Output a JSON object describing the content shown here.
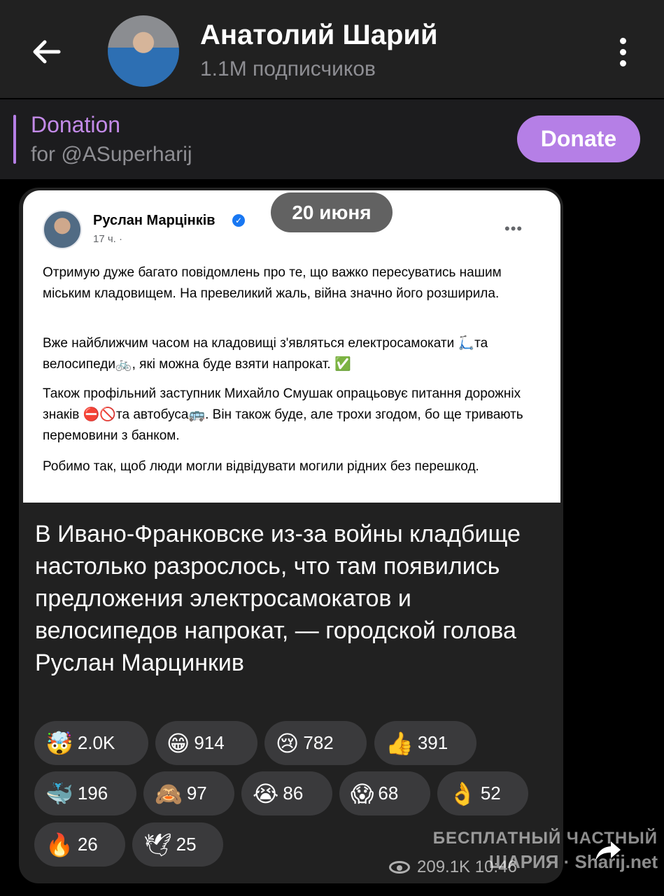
{
  "header": {
    "title": "Анатолий Шарий",
    "subtitle": "1.1M подписчиков"
  },
  "donation": {
    "title": "Donation",
    "subtitle": "for @ASuperharij",
    "button_label": "Donate",
    "accent_color": "#b57fe6"
  },
  "message": {
    "date": "20 июня",
    "fb_post": {
      "author": "Руслан Марцінків",
      "time": "17 ч. ·",
      "more": "•••",
      "paragraphs": [
        "Отримую дуже багато повідомлень про те, що важко пересуватись нашим міським кладовищем. На превеликий жаль, війна значно його розширила.",
        "Вже найближчим часом на кладовищі з'являться електросамокати 🛴та велосипеди🚲, які можна буде взяти напрокат. ✅",
        "Також профільний заступник Михайло Смушак опрацьовує питання дорожніх знаків ⛔🚫та автобуса🚌. Він також буде, але трохи згодом, бо ще тривають перемовини з банком.",
        "Робимо так, щоб люди могли відвідувати могили рідних без перешкод."
      ]
    },
    "text": "В Ивано-Франковске из-за войны кладбище настолько разрослось, что там появились предложения электросамокатов и велосипедов напрокат, — городской голова Руслан Марцинкив",
    "reactions": [
      {
        "emoji": "🤯",
        "count": "2.0K"
      },
      {
        "emoji": "😁",
        "count": "914"
      },
      {
        "emoji": "😢",
        "count": "782"
      },
      {
        "emoji": "👍",
        "count": "391"
      },
      {
        "emoji": "🐳",
        "count": "196"
      },
      {
        "emoji": "🙈",
        "count": "97"
      },
      {
        "emoji": "😭",
        "count": "86"
      },
      {
        "emoji": "😱",
        "count": "68"
      },
      {
        "emoji": "👌",
        "count": "52"
      },
      {
        "emoji": "🔥",
        "count": "26"
      },
      {
        "emoji": "🕊",
        "count": "25"
      }
    ],
    "views": "209.1K 10:46"
  },
  "watermark": {
    "line1": "БЕСПЛАТНЫЙ ЧАСТНЫЙ",
    "line2": "ШАРИЯ · Sharij.net"
  }
}
